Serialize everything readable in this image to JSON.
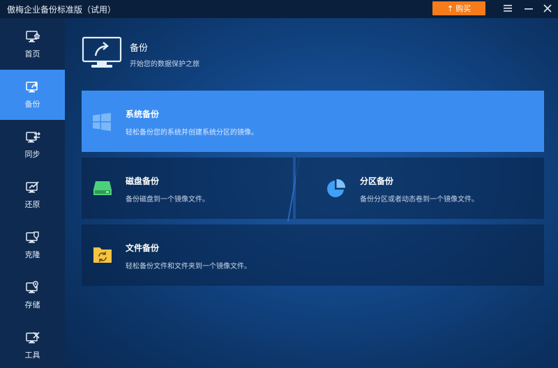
{
  "window": {
    "title": "傲梅企业备份标准版（试用）",
    "buy_label": "购买",
    "menu_icon": "menu-icon",
    "minimize_icon": "minimize-icon",
    "close_icon": "close-icon"
  },
  "sidebar": {
    "items": [
      {
        "label": "首页",
        "icon": "home-monitor-icon",
        "active": false
      },
      {
        "label": "备份",
        "icon": "backup-monitor-icon",
        "active": true
      },
      {
        "label": "同步",
        "icon": "sync-monitor-icon",
        "active": false
      },
      {
        "label": "还原",
        "icon": "restore-monitor-icon",
        "active": false
      },
      {
        "label": "克隆",
        "icon": "clone-monitor-icon",
        "active": false
      },
      {
        "label": "存储",
        "icon": "storage-monitor-icon",
        "active": false
      },
      {
        "label": "工具",
        "icon": "tools-monitor-icon",
        "active": false
      }
    ]
  },
  "header": {
    "title": "备份",
    "subtitle": "开始您的数据保护之旅"
  },
  "cards": {
    "system": {
      "title": "系统备份",
      "desc": "轻松备份您的系统并创建系统分区的镜像。"
    },
    "disk": {
      "title": "磁盘备份",
      "desc": "备份磁盘到一个镜像文件。"
    },
    "partition": {
      "title": "分区备份",
      "desc": "备份分区或者动态卷到一个镜像文件。"
    },
    "file": {
      "title": "文件备份",
      "desc": "轻松备份文件和文件夹到一个镜像文件。"
    }
  },
  "colors": {
    "accent": "#3a8cf0",
    "buy": "#f47c1b",
    "disk_icon": "#4cd17a",
    "file_icon": "#f5c542"
  }
}
